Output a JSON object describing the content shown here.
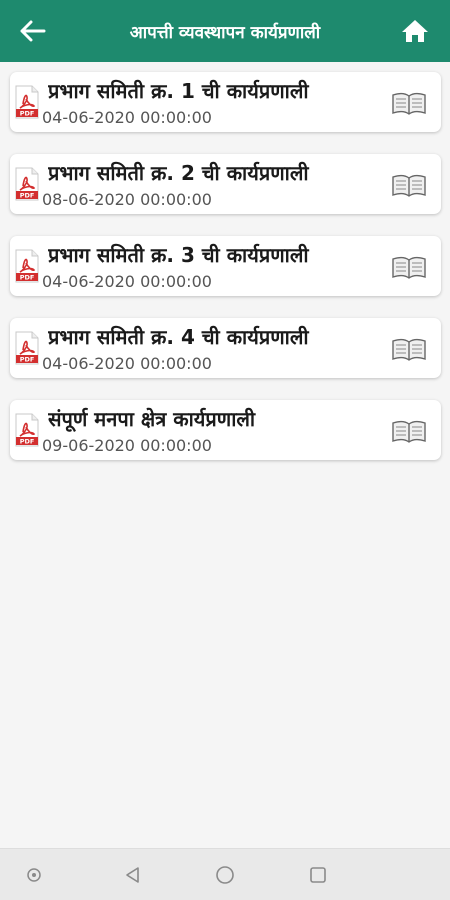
{
  "header": {
    "title": "आपत्ती व्यवस्थापन कार्यप्रणाली",
    "back_icon": "back-arrow-icon",
    "home_icon": "home-icon",
    "background_color": "#1e8a6e"
  },
  "documents": [
    {
      "title": "प्रभाग समिती क्र. 1 ची कार्यप्रणाली",
      "date": "04-06-2020 00:00:00",
      "file_icon": "pdf-icon",
      "action_icon": "open-book-icon"
    },
    {
      "title": "प्रभाग समिती क्र. 2 ची कार्यप्रणाली",
      "date": "08-06-2020 00:00:00",
      "file_icon": "pdf-icon",
      "action_icon": "open-book-icon"
    },
    {
      "title": "प्रभाग समिती क्र. 3 ची कार्यप्रणाली",
      "date": "04-06-2020 00:00:00",
      "file_icon": "pdf-icon",
      "action_icon": "open-book-icon"
    },
    {
      "title": "प्रभाग समिती क्र. 4 ची कार्यप्रणाली",
      "date": "04-06-2020 00:00:00",
      "file_icon": "pdf-icon",
      "action_icon": "open-book-icon"
    },
    {
      "title": "संपूर्ण मनपा क्षेत्र कार्यप्रणाली",
      "date": "09-06-2020 00:00:00",
      "file_icon": "pdf-icon",
      "action_icon": "open-book-icon"
    }
  ],
  "system_nav": {
    "buttons": [
      "accessibility-dot-icon",
      "back-triangle-icon",
      "home-circle-icon",
      "recents-square-icon"
    ]
  }
}
